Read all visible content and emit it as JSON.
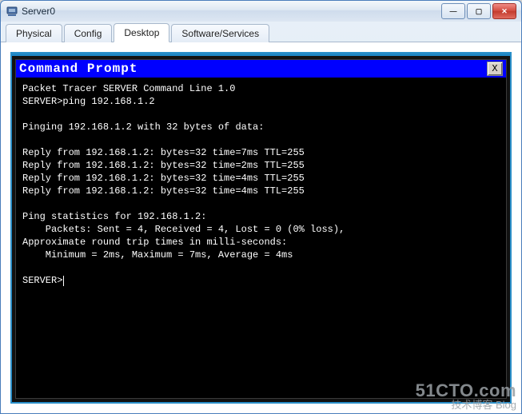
{
  "window": {
    "title": "Server0",
    "min_label": "—",
    "max_label": "▢",
    "close_label": "✕"
  },
  "tabs": [
    {
      "label": "Physical",
      "active": false
    },
    {
      "label": "Config",
      "active": false
    },
    {
      "label": "Desktop",
      "active": true
    },
    {
      "label": "Software/Services",
      "active": false
    }
  ],
  "cp": {
    "title": "Command Prompt",
    "close_label": "X"
  },
  "terminal": {
    "banner": "Packet Tracer SERVER Command Line 1.0",
    "prompt1": "SERVER>ping 192.168.1.2",
    "blank1": "",
    "pinging": "Pinging 192.168.1.2 with 32 bytes of data:",
    "blank2": "",
    "reply1": "Reply from 192.168.1.2: bytes=32 time=7ms TTL=255",
    "reply2": "Reply from 192.168.1.2: bytes=32 time=2ms TTL=255",
    "reply3": "Reply from 192.168.1.2: bytes=32 time=4ms TTL=255",
    "reply4": "Reply from 192.168.1.2: bytes=32 time=4ms TTL=255",
    "blank3": "",
    "stats1": "Ping statistics for 192.168.1.2:",
    "stats2": "    Packets: Sent = 4, Received = 4, Lost = 0 (0% loss),",
    "stats3": "Approximate round trip times in milli-seconds:",
    "stats4": "    Minimum = 2ms, Maximum = 7ms, Average = 4ms",
    "blank4": "",
    "prompt2": "SERVER>"
  },
  "watermark": {
    "line1": "51CTO.com",
    "line2": "技术博客    Blog"
  }
}
